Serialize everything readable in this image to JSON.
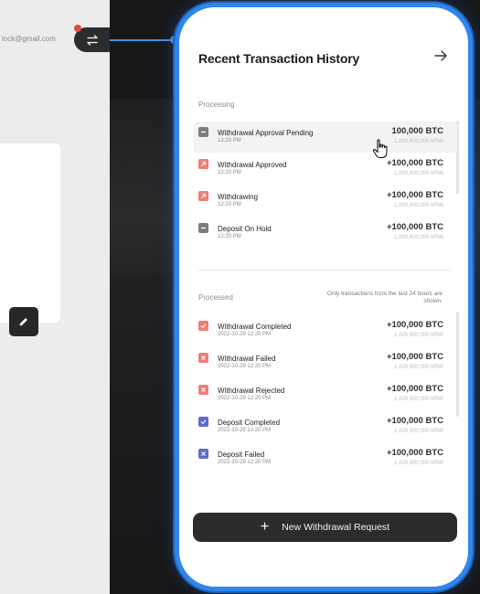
{
  "background_app": {
    "email": "lock@gmail.com"
  },
  "panel": {
    "title": "Recent Transaction History",
    "processing_label": "Processing",
    "processed_label": "Processed",
    "note": "Only transactions from the last 24 hours are shown.",
    "new_button_label": "New Withdrawal Request"
  },
  "processing": [
    {
      "name": "Withdrawal Approval Pending",
      "time": "12:20 PM",
      "amount": "100,000 BTC",
      "krw": "1,000,000,000 KRW",
      "icon": "minus-icon",
      "color": "#7d7d7d"
    },
    {
      "name": "Withdrawal Approved",
      "time": "12:20 PM",
      "amount": "+100,000 BTC",
      "krw": "1,000,000,000 KRW",
      "icon": "arrow-up-right-icon",
      "color": "#ef7d72"
    },
    {
      "name": "Withdrawing",
      "time": "12:20 PM",
      "amount": "+100,000 BTC",
      "krw": "1,000,000,000 KRW",
      "icon": "arrow-up-right-icon",
      "color": "#ef7d72"
    },
    {
      "name": "Deposit On Hold",
      "time": "12:20 PM",
      "amount": "+100,000 BTC",
      "krw": "1,000,000,000 KRW",
      "icon": "minus-icon",
      "color": "#7d7d7d"
    }
  ],
  "processed": [
    {
      "name": "Withdrawal Completed",
      "time": "2022-10-29 12:20 PM",
      "amount": "+100,000 BTC",
      "krw": "1,000,000,000 KRW",
      "icon": "check-icon",
      "color": "#ef7d72"
    },
    {
      "name": "Withdrawal Failed",
      "time": "2022-10-29 12:20 PM",
      "amount": "+100,000 BTC",
      "krw": "1,000,000,000 KRW",
      "icon": "x-icon",
      "color": "#ef7d72"
    },
    {
      "name": "Withdrawal Rejected",
      "time": "2022-10-29 12:20 PM",
      "amount": "+100,000 BTC",
      "krw": "1,000,000,000 KRW",
      "icon": "x-icon",
      "color": "#ef7d72"
    },
    {
      "name": "Deposit Completed",
      "time": "2022-10-29 12:20 PM",
      "amount": "+100,000 BTC",
      "krw": "1,000,000,000 KRW",
      "icon": "check-icon",
      "color": "#5b6bd1"
    },
    {
      "name": "Deposit Failed",
      "time": "2022-10-29 12:20 PM",
      "amount": "+100,000 BTC",
      "krw": "1,000,000,000 KRW",
      "icon": "x-icon",
      "color": "#5b6bd1"
    }
  ],
  "colors": {
    "accent_border": "#2e86ee",
    "button_bg": "#2c2c2c",
    "notification_dot": "#e5483f"
  }
}
